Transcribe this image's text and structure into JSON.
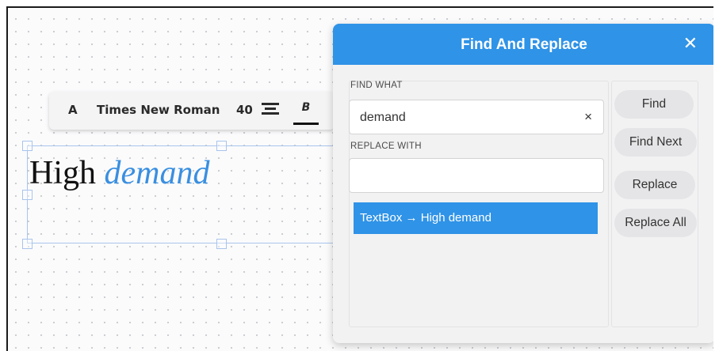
{
  "toolbar": {
    "font_icon_label": "A",
    "font_name": "Times New Roman",
    "font_size": "40",
    "align_icon": "align-center-icon",
    "bold_label": "B"
  },
  "canvas": {
    "textbox_text_plain": "High ",
    "textbox_text_highlight": "demand",
    "highlight_color": "#3a8fe0"
  },
  "dialog": {
    "title": "Find And Replace",
    "close_icon": "close-icon",
    "header_color": "#2f93e7",
    "find_label": "FIND WHAT",
    "find_value": "demand",
    "clear_icon": "×",
    "replace_label": "REPLACE WITH",
    "replace_value": "",
    "results": [
      "TextBox → High demand"
    ],
    "buttons": {
      "find": "Find",
      "find_next": "Find Next",
      "replace": "Replace",
      "replace_all": "Replace All"
    }
  }
}
